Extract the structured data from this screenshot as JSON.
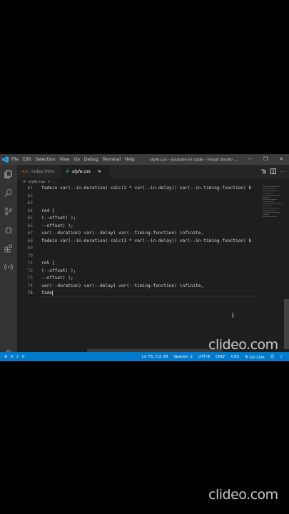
{
  "titlebar": {
    "menu": [
      "File",
      "Edit",
      "Selection",
      "View",
      "Go",
      "Debug",
      "Terminal",
      "Help"
    ],
    "title": "style.css - youtube vs code - Visual Studio ...",
    "controls": [
      "−",
      "❐",
      "✕"
    ]
  },
  "tabs": [
    {
      "label": "index.html",
      "icon": "html-icon"
    },
    {
      "label": "style.css",
      "icon": "css-icon",
      "close": "✕"
    }
  ],
  "breadcrumb": {
    "file": "style.css",
    "sep": ">",
    "more": "..."
  },
  "editor": {
    "lines": [
      {
        "n": "61",
        "text": "fadein var(--in-duration) calc(2 * var(--in-delay)) var(--in-timing-function) b"
      },
      {
        "n": "62",
        "text": ""
      },
      {
        "n": "63",
        "text": ""
      },
      {
        "n": "64",
        "text": "re4 {"
      },
      {
        "n": "65",
        "text": "(--offset) );"
      },
      {
        "n": "66",
        "text": "--offset) );"
      },
      {
        "n": "67",
        "text": "var(--duration) var(--delay) var(--timing-function) infinite,"
      },
      {
        "n": "68",
        "text": "fadein var(--in-duration) calc(3 * var(--in-delay)) var(--in-timing-function) b"
      },
      {
        "n": "69",
        "text": ""
      },
      {
        "n": "70",
        "text": ""
      },
      {
        "n": "71",
        "text": "re5 {"
      },
      {
        "n": "72",
        "text": "(--offset) );"
      },
      {
        "n": "73",
        "text": "--offset) );"
      },
      {
        "n": "74",
        "text": "var(--duration) var(--delay) var(--timing-function) infinite,"
      },
      {
        "n": "75",
        "text": "fade"
      }
    ]
  },
  "statusbar": {
    "errors": "0",
    "warnings": "0",
    "position": "Ln 75, Col 28",
    "spaces": "Spaces: 2",
    "encoding": "UTF-8",
    "eol": "CRLF",
    "language": "CSS",
    "golive": "Go Live"
  },
  "watermark": {
    "text": "clideo.com"
  }
}
